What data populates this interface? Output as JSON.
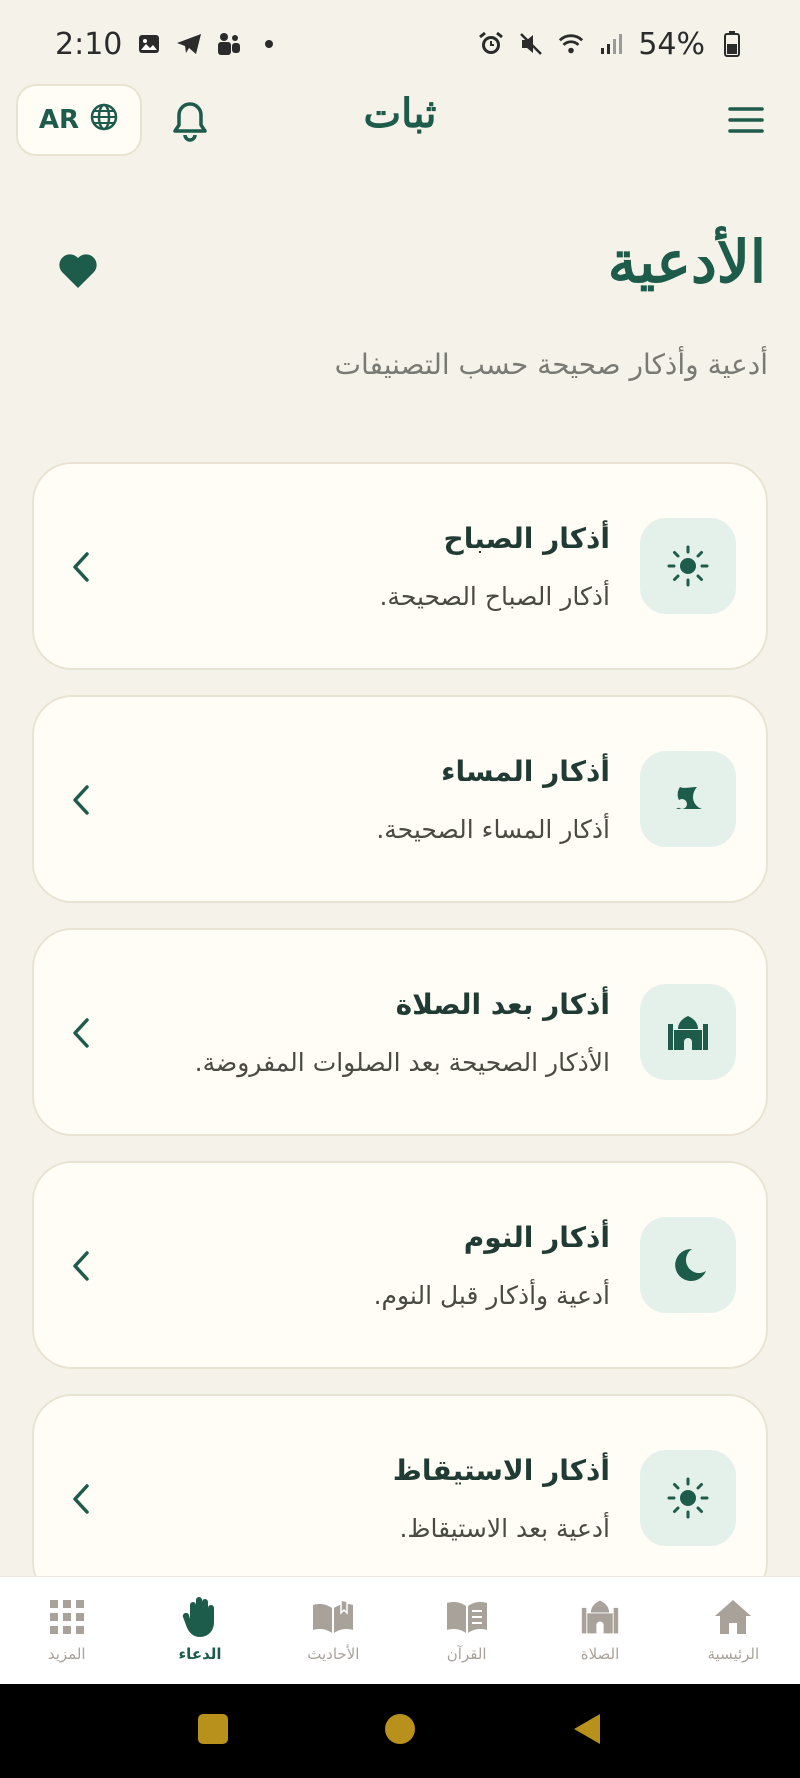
{
  "status": {
    "time": "2:10",
    "battery": "54%"
  },
  "header": {
    "lang": "AR",
    "title": "ثبات"
  },
  "page": {
    "title": "الأدعية",
    "subtitle": "أدعية وأذكار صحيحة حسب التصنيفات"
  },
  "cards": [
    {
      "title": "أذكار الصباح",
      "desc": "أذكار الصباح الصحيحة.",
      "icon": "sun-icon"
    },
    {
      "title": "أذكار المساء",
      "desc": "أذكار المساء الصحيحة.",
      "icon": "sunset-icon"
    },
    {
      "title": "أذكار بعد الصلاة",
      "desc": "الأذكار الصحيحة بعد الصلوات المفروضة.",
      "icon": "mosque-icon"
    },
    {
      "title": "أذكار النوم",
      "desc": "أدعية وأذكار قبل النوم.",
      "icon": "moon-icon"
    },
    {
      "title": "أذكار الاستيقاظ",
      "desc": "أدعية بعد الاستيقاظ.",
      "icon": "sun-icon"
    }
  ],
  "nav": [
    {
      "label": "الرئيسية",
      "icon": "home-icon"
    },
    {
      "label": "الصلاة",
      "icon": "mosque-icon"
    },
    {
      "label": "القرآن",
      "icon": "quran-icon"
    },
    {
      "label": "الأحاديث",
      "icon": "book-icon"
    },
    {
      "label": "الدعاء",
      "icon": "hand-icon",
      "active": true
    },
    {
      "label": "المزيد",
      "icon": "grid-icon"
    }
  ],
  "colors": {
    "accent": "#1D5B4B",
    "background": "#F5F2EA",
    "card": "#FFFDF5",
    "icon_bg": "#E4F1EA"
  }
}
